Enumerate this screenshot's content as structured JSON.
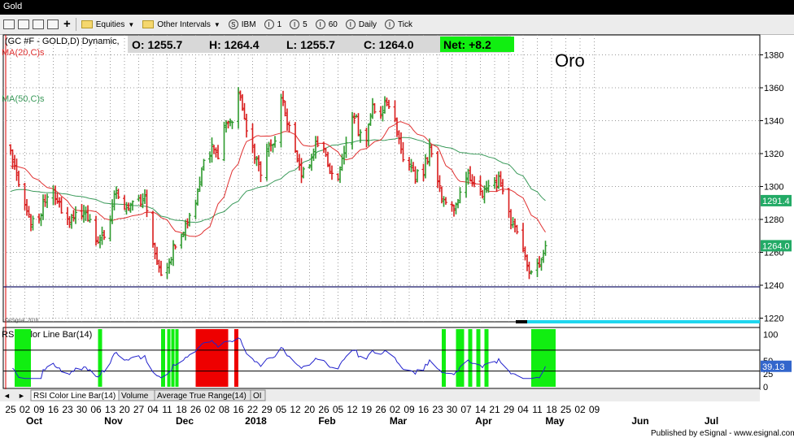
{
  "window": {
    "title": "Gold"
  },
  "toolbar": {
    "items": [
      {
        "icon": "folder-icon",
        "label": "Equities",
        "dropdown": true
      },
      {
        "icon": "folder-icon",
        "label": "Other Intervals",
        "dropdown": true
      },
      {
        "icon": "circle-s-icon",
        "letter": "S",
        "label": "IBM"
      },
      {
        "icon": "circle-i-icon",
        "letter": "I",
        "label": "1"
      },
      {
        "icon": "circle-i-icon",
        "letter": "I",
        "label": "5"
      },
      {
        "icon": "circle-i-icon",
        "letter": "I",
        "label": "60"
      },
      {
        "icon": "circle-i-icon",
        "letter": "I",
        "label": "Daily"
      },
      {
        "icon": "circle-i-icon",
        "letter": "I",
        "label": "Tick"
      }
    ]
  },
  "header": {
    "symbol": "(GC #F - GOLD,D) Dynamic,",
    "ohlc": {
      "open": "O:  1255.7",
      "high": "H:  1264.4",
      "low": "L:  1255.7",
      "close": "C:  1264.0",
      "net": "Net:  +8.2"
    },
    "ma20_label": "MA(20,C)s",
    "ma50_label": "MA(50,C)s",
    "annotation": "Oro",
    "watermark": "©eSignal, 2018"
  },
  "lower_tabs": [
    "RSI Color Line Bar(14)",
    "Volume",
    "Average True Range(14)",
    "OI"
  ],
  "footer": {
    "publisher": "Published by eSignal - www.esignal.com"
  },
  "colors": {
    "up": "#2e9a2e",
    "down": "#d81c1c",
    "ma20": "#e03030",
    "ma50": "#3a9a5a",
    "rsi": "#2222cc",
    "overbought": "#ee0000",
    "oversold": "#11ee11",
    "price_tag": "#22aa66",
    "rsi_tag": "#3366cc"
  },
  "chart_data": [
    {
      "type": "candlestick",
      "title": "Gold daily bars",
      "ylim": [
        1215,
        1395
      ],
      "yticks": [
        1220,
        1240,
        1260,
        1280,
        1300,
        1320,
        1340,
        1360,
        1380
      ],
      "price_labels": {
        "ma50_value": "1291.4",
        "last_price": "1264.0",
        "ma50": 1291.4,
        "last": 1264.0
      },
      "support_level": 1239,
      "keypoints": [
        {
          "d": 0,
          "p": 1322
        },
        {
          "d": 5,
          "p": 1292
        },
        {
          "d": 12,
          "p": 1275
        },
        {
          "d": 20,
          "p": 1300
        },
        {
          "d": 28,
          "p": 1279
        },
        {
          "d": 36,
          "p": 1283
        },
        {
          "d": 43,
          "p": 1268
        },
        {
          "d": 48,
          "p": 1275
        },
        {
          "d": 52,
          "p": 1298
        },
        {
          "d": 56,
          "p": 1285
        },
        {
          "d": 61,
          "p": 1290
        },
        {
          "d": 66,
          "p": 1292
        },
        {
          "d": 70,
          "p": 1262
        },
        {
          "d": 74,
          "p": 1244
        },
        {
          "d": 78,
          "p": 1256
        },
        {
          "d": 84,
          "p": 1273
        },
        {
          "d": 88,
          "p": 1279
        },
        {
          "d": 92,
          "p": 1296
        },
        {
          "d": 95,
          "p": 1318
        },
        {
          "d": 99,
          "p": 1322
        },
        {
          "d": 102,
          "p": 1318
        },
        {
          "d": 105,
          "p": 1338
        },
        {
          "d": 109,
          "p": 1340
        },
        {
          "d": 112,
          "p": 1356
        },
        {
          "d": 114,
          "p": 1348
        },
        {
          "d": 117,
          "p": 1325
        },
        {
          "d": 120,
          "p": 1320
        },
        {
          "d": 123,
          "p": 1310
        },
        {
          "d": 127,
          "p": 1325
        },
        {
          "d": 130,
          "p": 1330
        },
        {
          "d": 133,
          "p": 1357
        },
        {
          "d": 136,
          "p": 1338
        },
        {
          "d": 139,
          "p": 1325
        },
        {
          "d": 143,
          "p": 1310
        },
        {
          "d": 147,
          "p": 1312
        },
        {
          "d": 150,
          "p": 1328
        },
        {
          "d": 154,
          "p": 1322
        },
        {
          "d": 158,
          "p": 1308
        },
        {
          "d": 161,
          "p": 1305
        },
        {
          "d": 164,
          "p": 1320
        },
        {
          "d": 167,
          "p": 1345
        },
        {
          "d": 170,
          "p": 1340
        },
        {
          "d": 173,
          "p": 1325
        },
        {
          "d": 175,
          "p": 1330
        },
        {
          "d": 178,
          "p": 1347
        },
        {
          "d": 181,
          "p": 1343
        },
        {
          "d": 184,
          "p": 1352
        },
        {
          "d": 187,
          "p": 1347
        },
        {
          "d": 190,
          "p": 1335
        },
        {
          "d": 193,
          "p": 1318
        },
        {
          "d": 196,
          "p": 1315
        },
        {
          "d": 199,
          "p": 1305
        },
        {
          "d": 203,
          "p": 1310
        },
        {
          "d": 206,
          "p": 1322
        },
        {
          "d": 209,
          "p": 1313
        },
        {
          "d": 212,
          "p": 1292
        },
        {
          "d": 215,
          "p": 1290
        },
        {
          "d": 218,
          "p": 1285
        },
        {
          "d": 222,
          "p": 1300
        },
        {
          "d": 225,
          "p": 1305
        },
        {
          "d": 229,
          "p": 1300
        },
        {
          "d": 232,
          "p": 1295
        },
        {
          "d": 235,
          "p": 1302
        },
        {
          "d": 238,
          "p": 1300
        },
        {
          "d": 240,
          "p": 1305
        },
        {
          "d": 243,
          "p": 1298
        },
        {
          "d": 246,
          "p": 1277
        },
        {
          "d": 250,
          "p": 1268
        },
        {
          "d": 253,
          "p": 1257
        },
        {
          "d": 256,
          "p": 1248
        },
        {
          "d": 258,
          "p": 1253
        },
        {
          "d": 261,
          "p": 1254
        },
        {
          "d": 263,
          "p": 1264
        }
      ],
      "x_axis": {
        "day_start": "2017-09-25",
        "day_labels": [
          {
            "d": 0,
            "t": "25"
          },
          {
            "d": 7,
            "t": "02"
          },
          {
            "d": 14,
            "t": "09"
          },
          {
            "d": 21,
            "t": "16"
          },
          {
            "d": 28,
            "t": "23"
          },
          {
            "d": 35,
            "t": "30"
          },
          {
            "d": 42,
            "t": "06"
          },
          {
            "d": 49,
            "t": "13"
          },
          {
            "d": 56,
            "t": "20"
          },
          {
            "d": 63,
            "t": "27"
          },
          {
            "d": 70,
            "t": "04"
          },
          {
            "d": 77,
            "t": "11"
          },
          {
            "d": 84,
            "t": "18"
          },
          {
            "d": 91,
            "t": "26"
          },
          {
            "d": 98,
            "t": "02"
          },
          {
            "d": 105,
            "t": "08"
          },
          {
            "d": 112,
            "t": "16"
          },
          {
            "d": 119,
            "t": "22"
          },
          {
            "d": 126,
            "t": "29"
          },
          {
            "d": 133,
            "t": "05"
          },
          {
            "d": 140,
            "t": "12"
          },
          {
            "d": 147,
            "t": "20"
          },
          {
            "d": 154,
            "t": "26"
          },
          {
            "d": 161,
            "t": "05"
          },
          {
            "d": 168,
            "t": "12"
          },
          {
            "d": 175,
            "t": "19"
          },
          {
            "d": 182,
            "t": "26"
          },
          {
            "d": 189,
            "t": "02"
          },
          {
            "d": 196,
            "t": "09"
          },
          {
            "d": 203,
            "t": "16"
          },
          {
            "d": 210,
            "t": "23"
          },
          {
            "d": 217,
            "t": "30"
          },
          {
            "d": 224,
            "t": "07"
          },
          {
            "d": 231,
            "t": "14"
          },
          {
            "d": 238,
            "t": "21"
          },
          {
            "d": 245,
            "t": "29"
          },
          {
            "d": 252,
            "t": "04"
          },
          {
            "d": 259,
            "t": "11"
          },
          {
            "d": 266,
            "t": "18"
          },
          {
            "d": 273,
            "t": "25"
          },
          {
            "d": 280,
            "t": "02"
          },
          {
            "d": 287,
            "t": "09"
          }
        ],
        "month_labels": [
          {
            "d": 10,
            "t": "Oct"
          },
          {
            "d": 49,
            "t": "Nov"
          },
          {
            "d": 84,
            "t": "Dec"
          },
          {
            "d": 119,
            "t": "2018"
          },
          {
            "d": 154,
            "t": "Feb"
          },
          {
            "d": 189,
            "t": "Mar"
          },
          {
            "d": 231,
            "t": "Apr"
          },
          {
            "d": 266,
            "t": "May"
          },
          {
            "d": 308,
            "t": "Jun"
          },
          {
            "d": 343,
            "t": "Jul"
          }
        ]
      }
    },
    {
      "type": "line",
      "title": "RSI Color Line Bar(14)",
      "ylim": [
        -12,
        108
      ],
      "yticks": [
        0,
        25,
        50,
        100
      ],
      "levels": {
        "overbought": 70,
        "oversold": 30
      },
      "current_value": "39.13",
      "overbought_zones": [
        [
          91,
          107
        ],
        [
          110,
          112
        ]
      ],
      "oversold_zones": [
        [
          2,
          10
        ],
        [
          43,
          45
        ],
        [
          74,
          76
        ],
        [
          77,
          78
        ],
        [
          79,
          80
        ],
        [
          81,
          82
        ],
        [
          212,
          214
        ],
        [
          219,
          223
        ],
        [
          225,
          227
        ],
        [
          229,
          231
        ],
        [
          233,
          235
        ],
        [
          256,
          268
        ]
      ]
    }
  ]
}
